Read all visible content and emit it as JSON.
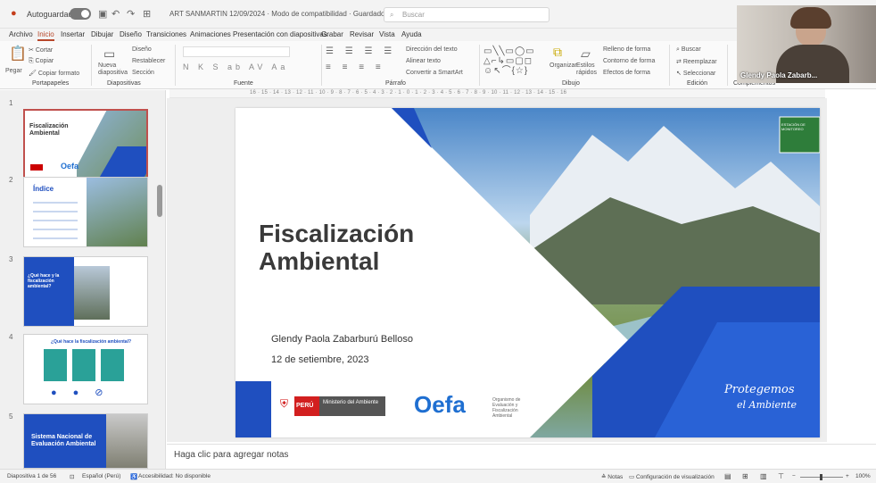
{
  "titlebar": {
    "autosave_label": "Autoguardado",
    "document_title": "ART SANMARTIN 12/09/2024 · Modo de compatibilidad · Guardado en este PC",
    "search_placeholder": "Buscar"
  },
  "menu": [
    "Archivo",
    "Inicio",
    "Insertar",
    "Dibujar",
    "Diseño",
    "Transiciones",
    "Animaciones",
    "Presentación con diapositivas",
    "Grabar",
    "Revisar",
    "Vista",
    "Ayuda"
  ],
  "ribbon": {
    "paste": "Pegar",
    "cut": "Cortar",
    "copy": "Copiar",
    "copy_format": "Copiar formato",
    "clipboard_group": "Portapapeles",
    "new_slide": "Nueva diapositiva",
    "layout": "Diseño",
    "reset": "Restablecer",
    "section": "Sección",
    "slides_group": "Diapositivas",
    "font_group": "Fuente",
    "text_direction": "Dirección del texto",
    "align_text": "Alinear texto",
    "convert_smartart": "Convertir a SmartArt",
    "paragraph_group": "Párrafo",
    "arrange": "Organizar",
    "quick_styles": "Estilos rápidos",
    "shape_fill": "Relleno de forma",
    "shape_outline": "Contorno de forma",
    "shape_effects": "Efectos de forma",
    "drawing_group": "Dibujo",
    "find": "Buscar",
    "replace": "Reemplazar",
    "select": "Seleccionar",
    "editing_group": "Edición",
    "addins_group": "Complementos"
  },
  "ruler_text": "16 · 15 · 14 · 13 · 12 · 11 · 10 · 9 · 8 · 7 · 6 · 5 · 4 · 3 · 2 · 1 · 0 · 1 · 2 · 3 · 4 · 5 · 6 · 7 · 8 · 9 · 10 · 11 · 12 · 13 · 14 · 15 · 16",
  "thumbnails": [
    {
      "num": "1",
      "title": "Fiscalización Ambiental",
      "footer": "Oefa"
    },
    {
      "num": "2",
      "title": "Índice"
    },
    {
      "num": "3",
      "title": "¿Qué hace y la fiscalización ambiental?"
    },
    {
      "num": "4",
      "title": "¿Qué hace la fiscalización ambiental?"
    },
    {
      "num": "5",
      "title": "Sistema Nacional de Evaluación Ambiental"
    }
  ],
  "slide": {
    "title_line1": "Fiscalización",
    "title_line2": "Ambiental",
    "presenter": "Glendy Paola Zabarburú Belloso",
    "date": "12 de setiembre, 2023",
    "peru": "PERÚ",
    "ministry": "Ministerio del Ambiente",
    "oefa": "Oefa",
    "oefa_sub": "Organismo de Evaluación y Fiscalización Ambiental",
    "slogan1": "Protegemos",
    "slogan2": "el Ambiente",
    "sign": "ESTACIÓN DE MONITOREO"
  },
  "notes_placeholder": "Haga clic para agregar notas",
  "status": {
    "slide_count": "Diapositiva 1 de 56",
    "language": "Español (Perú)",
    "accessibility": "Accesibilidad: No disponible",
    "notes": "Notas",
    "view_settings": "Configuración de visualización",
    "zoom": "100%"
  },
  "webcam": {
    "name": "Glendy Paola Zabarb..."
  },
  "colors": {
    "accent": "#b7472a",
    "slide_blue": "#1f4fbf",
    "slide_title": "#3a3a3a"
  }
}
